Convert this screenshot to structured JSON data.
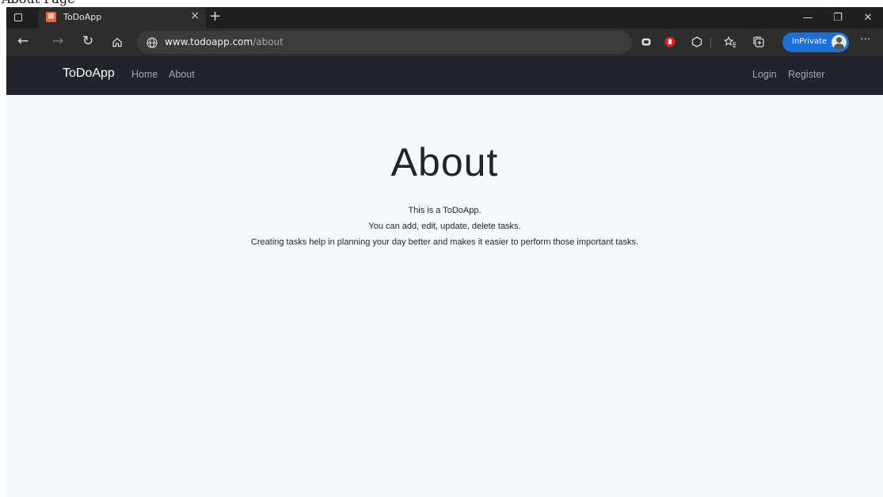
{
  "caption": {
    "text": "About Page"
  },
  "browser": {
    "tab": {
      "favicon_icon": "xampp-icon",
      "title": "ToDoApp",
      "close": "×"
    },
    "new_tab": "+",
    "window_controls": {
      "minimize": "—",
      "restore": "❐",
      "close": "✕"
    },
    "toolbar": {
      "back": "←",
      "forward": "→",
      "refresh": "↻",
      "url_host": "www.todoapp.com",
      "url_path": "/about",
      "inprivate_label": "InPrivate",
      "more": "···"
    }
  },
  "navbar": {
    "brand": "ToDoApp",
    "links": [
      "Home",
      "About"
    ],
    "right_links": [
      "Login",
      "Register"
    ]
  },
  "main": {
    "title": "About",
    "paragraphs": [
      "This is a ToDoApp.",
      "You can add, edit, update, delete tasks.",
      "Creating tasks help in planning your day better and makes it easier to perform those important tasks."
    ]
  },
  "colors": {
    "navbar_bg": "#212529",
    "page_bg": "#f8f9fa",
    "inprivate_bg": "#1a6fd8",
    "favicon": "#ea6a3d"
  }
}
